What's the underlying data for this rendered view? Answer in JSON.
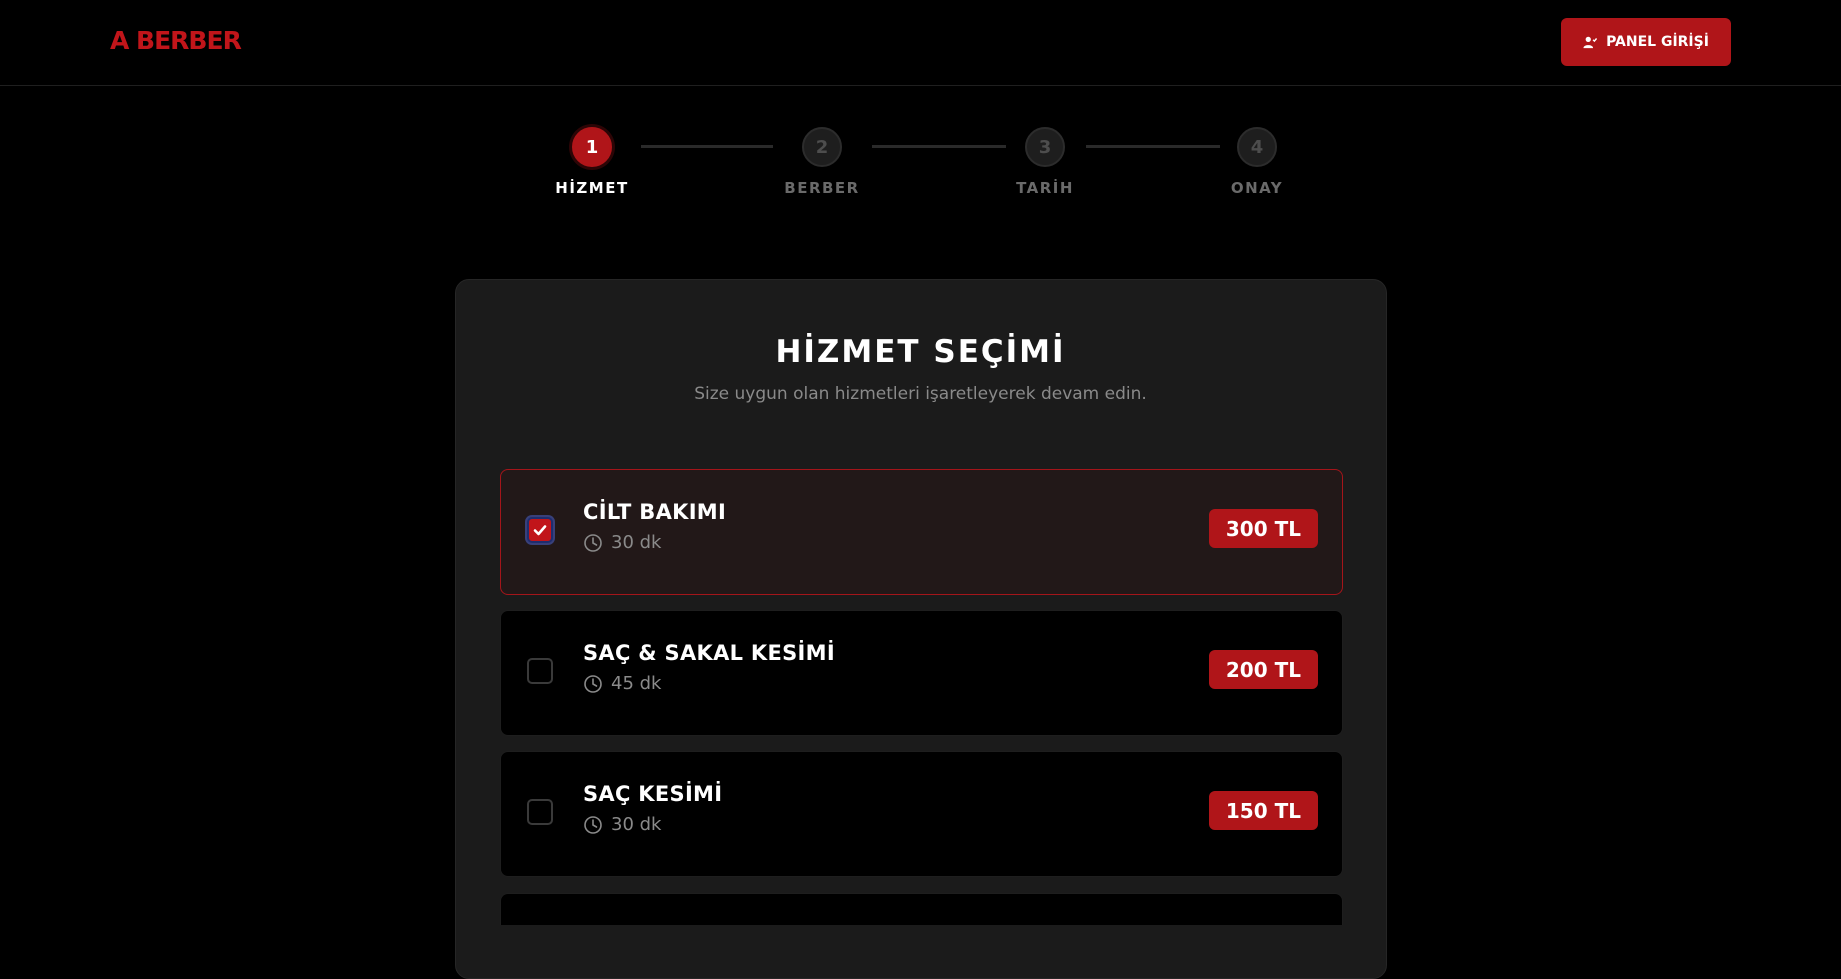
{
  "header": {
    "logo": "A BERBER",
    "panel_button": "PANEL GİRİŞİ"
  },
  "stepper": {
    "steps": [
      {
        "number": "1",
        "label": "HİZMET",
        "active": true
      },
      {
        "number": "2",
        "label": "BERBER",
        "active": false
      },
      {
        "number": "3",
        "label": "TARİH",
        "active": false
      },
      {
        "number": "4",
        "label": "ONAY",
        "active": false
      }
    ]
  },
  "card": {
    "title": "HİZMET SEÇİMİ",
    "subtitle": "Size uygun olan hizmetleri işaretleyerek devam edin."
  },
  "services": [
    {
      "name": "CİLT BAKIMI",
      "duration": "30 dk",
      "price": "300 TL",
      "selected": true
    },
    {
      "name": "SAÇ & SAKAL KESİMİ",
      "duration": "45 dk",
      "price": "200 TL",
      "selected": false
    },
    {
      "name": "SAÇ KESİMİ",
      "duration": "30 dk",
      "price": "150 TL",
      "selected": false
    },
    {
      "name": "",
      "duration": "",
      "price": "",
      "selected": false
    }
  ],
  "colors": {
    "accent": "#b01519",
    "background": "#000000",
    "card": "#1b1b1b"
  }
}
